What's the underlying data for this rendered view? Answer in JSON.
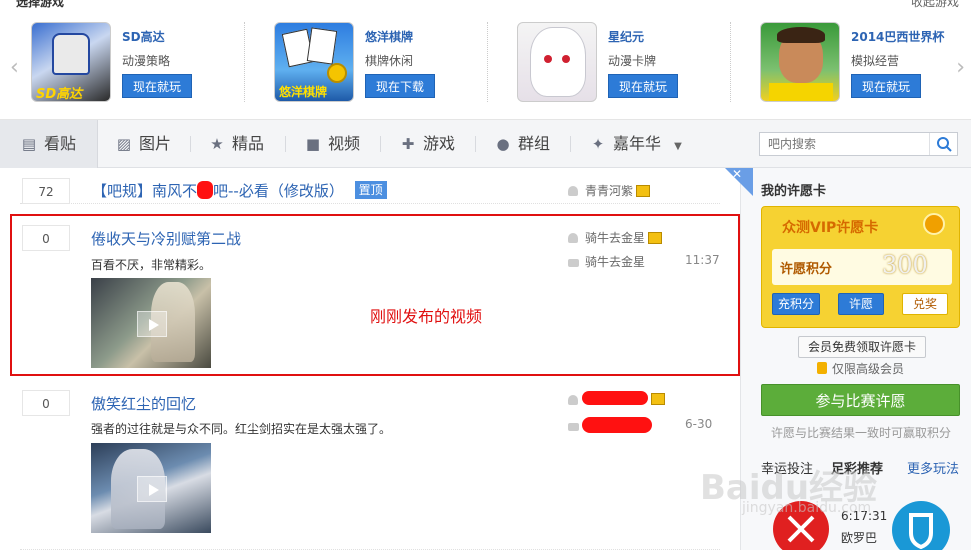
{
  "games": {
    "title": "选择游戏",
    "collapse": "收起游戏",
    "items": [
      {
        "name": "SD高达",
        "category": "动漫策略",
        "button": "现在就玩"
      },
      {
        "name": "悠洋棋牌",
        "category": "棋牌休闲",
        "button": "现在下载"
      },
      {
        "name": "星纪元",
        "category": "动漫卡牌",
        "button": "现在就玩"
      },
      {
        "name": "2014巴西世界杯",
        "category": "模拟经营",
        "button": "现在就玩"
      }
    ],
    "thumb_text": {
      "g1": "SD高达",
      "g2": "悠洋棋牌"
    }
  },
  "nav": {
    "tabs": [
      {
        "label": "看贴",
        "icon": "document-icon"
      },
      {
        "label": "图片",
        "icon": "picture-icon"
      },
      {
        "label": "精品",
        "icon": "star-icon"
      },
      {
        "label": "视频",
        "icon": "video-icon"
      },
      {
        "label": "游戏",
        "icon": "gamepad-icon"
      },
      {
        "label": "群组",
        "icon": "chat-icon"
      },
      {
        "label": "嘉年华",
        "icon": "carnival-icon"
      }
    ],
    "search_placeholder": "吧内搜索"
  },
  "threads": [
    {
      "count": "72",
      "title": "【吧规】南风不",
      "title_tail": "吧--必看（修改版）",
      "badge": "置顶",
      "author": "青青河紫"
    },
    {
      "count": "0",
      "title": "倦收天与冷别赋第二战",
      "excerpt": "百看不厌，非常精彩。",
      "author": "骑牛去金星",
      "last_reply": "骑牛去金星",
      "time": "11:37"
    },
    {
      "count": "0",
      "title": "傲笑红尘的回忆",
      "excerpt": "强者的过往就是与众不同。红尘剑招实在是太强太强了。",
      "time": "6-30"
    }
  ],
  "annotation": "刚刚发布的视频",
  "sidebar": {
    "title": "我的许愿卡",
    "vip_title": "众测VIP许愿卡",
    "score_label": "许愿积分",
    "score": "300",
    "btn_recharge": "充积分",
    "btn_wish": "许愿",
    "btn_exchange": "兑奖",
    "free_button": "会员免费领取许愿卡",
    "senior_only": "仅限高级会员",
    "join_button": "参与比赛许愿",
    "consistent": "许愿与比赛结果一致时可赢取积分",
    "tab_luck": "幸运投注",
    "tab_recommend": "足彩推荐",
    "tab_more": "更多玩法",
    "time": "6:17:31",
    "team": "欧罗巴"
  },
  "watermark": "Baidu经验",
  "watermark_url": "jingyan.baidu.com"
}
